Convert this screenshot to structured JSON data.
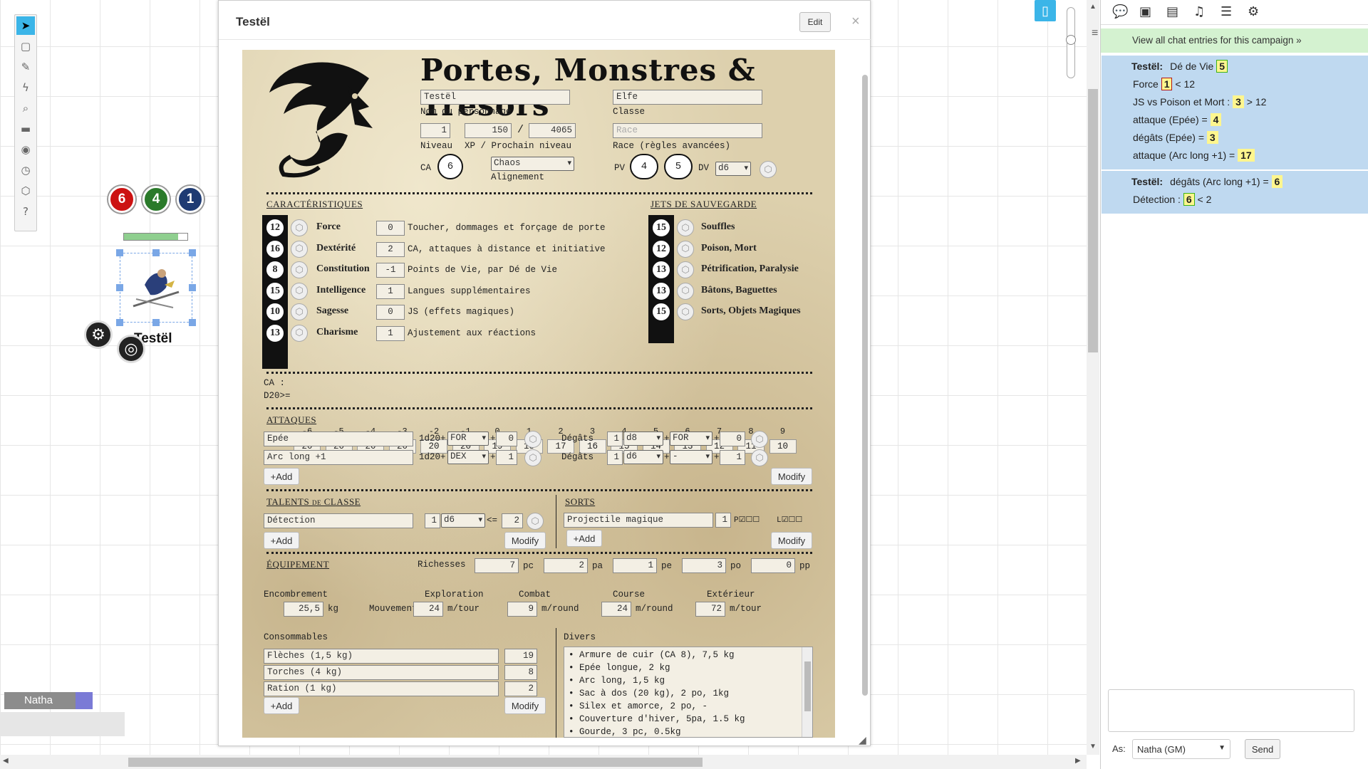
{
  "tabletop": {
    "token": {
      "name": "Testël",
      "bubbles": [
        "6",
        "4",
        "1"
      ],
      "bar_fraction": 0.85
    },
    "player": {
      "name": "Natha"
    }
  },
  "sheet": {
    "title": "Testël",
    "edit_label": "Edit",
    "close_label": "×",
    "game_title": "Portes, Monstres & Trésors",
    "char_name": "Testël",
    "char_name_label": "Nom du personnage",
    "class": "Elfe",
    "class_label": "Classe",
    "niveau": "1",
    "xp": "150",
    "xp_sep": "/",
    "next_level": "4065",
    "niveau_label": "Niveau",
    "xp_label": "XP / Prochain niveau",
    "race_placeholder": "Race",
    "race_label": "Race (règles avancées)",
    "ca_label": "CA",
    "ca": "6",
    "alignement": "Chaos",
    "alignement_label": "Alignement",
    "pv_label": "PV",
    "pv": "4",
    "pv_max": "5",
    "dv_label": "DV",
    "dv": "d6",
    "caracteristiques_title": "CARACTÉRISTIQUES",
    "caracs": [
      {
        "score": "12",
        "name": "Force",
        "mod": "0",
        "desc": "Toucher, dommages et forçage de porte"
      },
      {
        "score": "16",
        "name": "Dextérité",
        "mod": "2",
        "desc": "CA, attaques à distance et initiative"
      },
      {
        "score": "8",
        "name": "Constitution",
        "mod": "-1",
        "desc": "Points de Vie, par Dé de Vie"
      },
      {
        "score": "15",
        "name": "Intelligence",
        "mod": "1",
        "desc": "Langues supplémentaires"
      },
      {
        "score": "10",
        "name": "Sagesse",
        "mod": "0",
        "desc": "JS (effets magiques)"
      },
      {
        "score": "13",
        "name": "Charisme",
        "mod": "1",
        "desc": "Ajustement aux réactions"
      }
    ],
    "saves_title": "JETS DE SAUVEGARDE",
    "saves": [
      {
        "score": "15",
        "name": "Souffles"
      },
      {
        "score": "12",
        "name": "Poison, Mort"
      },
      {
        "score": "13",
        "name": "Pétrification, Paralysie"
      },
      {
        "score": "13",
        "name": "Bâtons, Baguettes"
      },
      {
        "score": "15",
        "name": "Sorts, Objets Magiques"
      }
    ],
    "ac_table": {
      "ca_label": "CA :",
      "d20_label": "D20>=",
      "ca": [
        "-6",
        "-5",
        "-4",
        "-3",
        "-2",
        "-1",
        "0",
        "1",
        "2",
        "3",
        "4",
        "5",
        "6",
        "7",
        "8",
        "9"
      ],
      "d20": [
        "20",
        "20",
        "20",
        "20",
        "20",
        "20",
        "19",
        "18",
        "17",
        "16",
        "15",
        "14",
        "13",
        "12",
        "11",
        "10"
      ]
    },
    "attacks_title": "ATTAQUES",
    "attacks": [
      {
        "name": "Epée",
        "dice": "1d20+",
        "stat": "FOR",
        "plus": "+",
        "bonus": "0",
        "dmg_label": "Dégâts",
        "dmg_n": "1",
        "dmg_die": "d8",
        "dmg_stat": "FOR",
        "dmg_bonus": "0"
      },
      {
        "name": "Arc long +1",
        "dice": "1d20+",
        "stat": "DEX",
        "plus": "+",
        "bonus": "1",
        "dmg_label": "Dégâts",
        "dmg_n": "1",
        "dmg_die": "d6",
        "dmg_stat": "-",
        "dmg_bonus": "1"
      }
    ],
    "add_label": "+Add",
    "modify_label": "Modify",
    "talents_title": "TALENTS de CLASSE",
    "talent": {
      "name": "Détection",
      "n": "1",
      "die": "d6",
      "cmp": "<=",
      "target": "2"
    },
    "sorts_title": "SORTS",
    "sort": {
      "name": "Projectile magique",
      "level": "1",
      "p": "P",
      "l": "L"
    },
    "equip_title": "ÉQUIPEMENT",
    "richesses_label": "Richesses",
    "coins": [
      {
        "v": "7",
        "u": "pc"
      },
      {
        "v": "2",
        "u": "pa"
      },
      {
        "v": "1",
        "u": "pe"
      },
      {
        "v": "3",
        "u": "po"
      },
      {
        "v": "0",
        "u": "pp"
      }
    ],
    "encombrement_label": "Encombrement",
    "encombrement": "25,5",
    "kg": "kg",
    "mouvement_label": "Mouvement",
    "moves": [
      {
        "label": "Exploration",
        "v": "24",
        "u": "m/tour"
      },
      {
        "label": "Combat",
        "v": "9",
        "u": "m/round"
      },
      {
        "label": "Course",
        "v": "24",
        "u": "m/round"
      },
      {
        "label": "Extérieur",
        "v": "72",
        "u": "m/tour"
      }
    ],
    "consommables_label": "Consommables",
    "consommables": [
      {
        "name": "Flèches (1,5 kg)",
        "qty": "19"
      },
      {
        "name": "Torches (4 kg)",
        "qty": "8"
      },
      {
        "name": "Ration (1 kg)",
        "qty": "2"
      }
    ],
    "divers_label": "Divers",
    "divers": [
      "• Armure de cuir (CA 8), 7,5 kg",
      "• Epée longue, 2 kg",
      "• Arc long, 1,5 kg",
      "• Sac à dos (20 kg), 2 po, 1kg",
      "• Silex et amorce, 2 po, -",
      "• Couverture d'hiver, 5pa, 1.5 kg",
      "• Gourde, 3 pc, 0.5kg"
    ]
  },
  "chat": {
    "view_all": "View all chat entries for this campaign »",
    "messages": [
      {
        "who": "Testël:",
        "lines": [
          {
            "text": "Dé de Vie",
            "roll": "5",
            "after": "",
            "style": "crit"
          },
          {
            "text": "Force",
            "roll": "1",
            "after": "< 12",
            "style": "fail"
          },
          {
            "text": "JS vs Poison et Mort :",
            "roll": "3",
            "after": "> 12",
            "style": ""
          },
          {
            "text": "attaque (Epée) =",
            "roll": "4",
            "after": "",
            "style": ""
          },
          {
            "text": "dégâts (Epée) =",
            "roll": "3",
            "after": "",
            "style": ""
          },
          {
            "text": "attaque (Arc long +1) =",
            "roll": "17",
            "after": "",
            "style": ""
          }
        ]
      },
      {
        "who": "Testël:",
        "lines": [
          {
            "text": "dégâts (Arc long +1) =",
            "roll": "6",
            "after": "",
            "style": ""
          },
          {
            "text": "Détection :",
            "roll": "6",
            "after": "< 2",
            "style": "crit"
          }
        ]
      }
    ],
    "as_label": "As:",
    "as_value": "Natha (GM)",
    "send_label": "Send",
    "input_value": ""
  }
}
